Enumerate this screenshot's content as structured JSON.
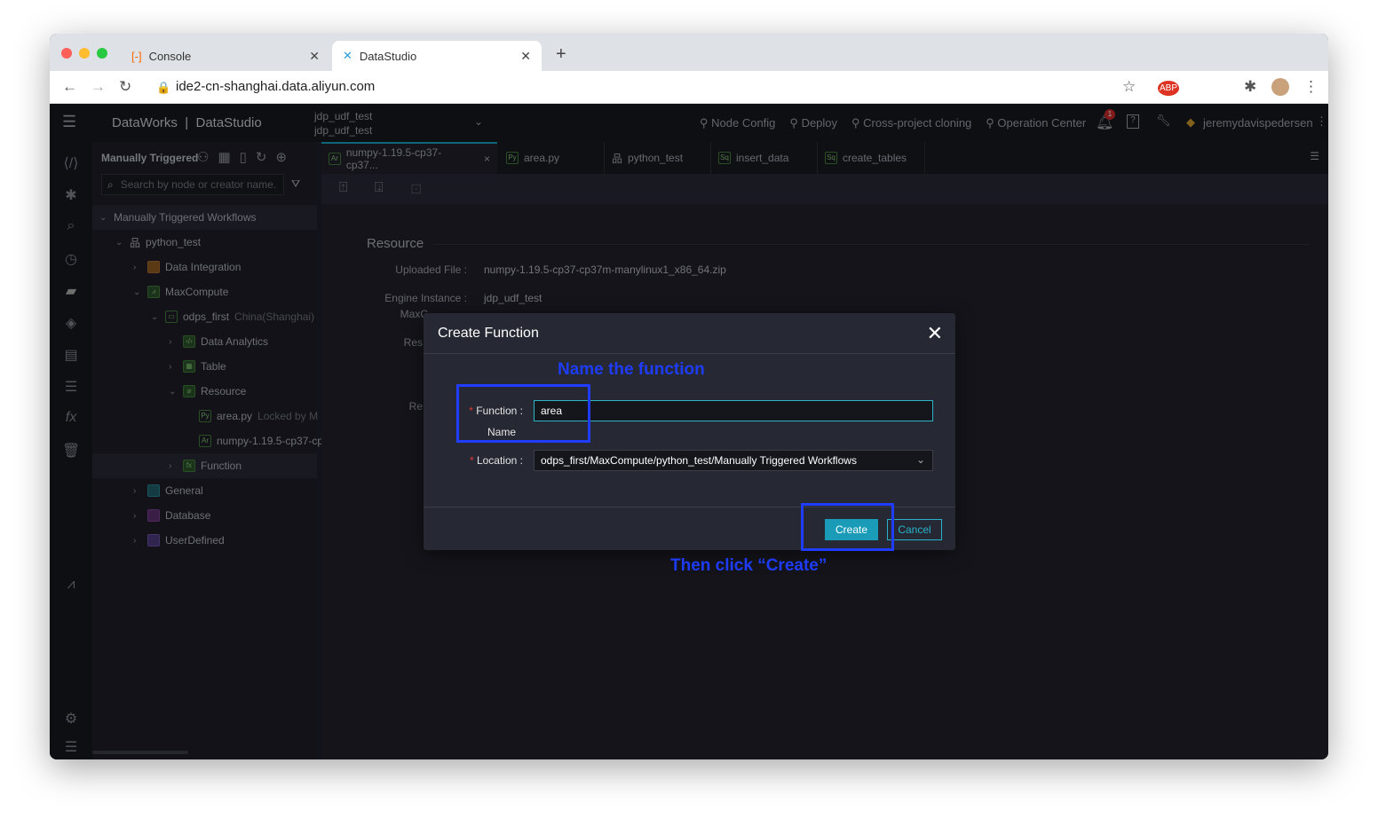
{
  "browser": {
    "tabs": [
      {
        "label": "Console"
      },
      {
        "label": "DataStudio"
      }
    ],
    "url": "ide2-cn-shanghai.data.aliyun.com"
  },
  "header": {
    "brand": "DataWorks",
    "product": "DataStudio",
    "workspace_line1": "jdp_udf_test",
    "workspace_line2": "jdp_udf_test",
    "links": [
      "Node Config",
      "Deploy",
      "Cross-project cloning",
      "Operation Center"
    ],
    "notification_count": "1",
    "user": "jeremydavispedersen"
  },
  "tree": {
    "title": "Manually Triggered",
    "search_placeholder": "Search by node or creator name.",
    "root": "Manually Triggered Workflows",
    "items": [
      {
        "label": "python_test",
        "note": ""
      },
      {
        "label": "Data Integration",
        "note": ""
      },
      {
        "label": "MaxCompute",
        "note": ""
      },
      {
        "label": "odps_first",
        "note": "China(Shanghai)"
      },
      {
        "label": "Data Analytics",
        "note": ""
      },
      {
        "label": "Table",
        "note": ""
      },
      {
        "label": "Resource",
        "note": ""
      },
      {
        "label": "area.py",
        "note": "Locked by M"
      },
      {
        "label": "numpy-1.19.5-cp37-cp",
        "note": ""
      },
      {
        "label": "Function",
        "note": ""
      },
      {
        "label": "General",
        "note": ""
      },
      {
        "label": "Database",
        "note": ""
      },
      {
        "label": "UserDefined",
        "note": ""
      }
    ]
  },
  "editor": {
    "tabs": [
      {
        "badge": "Ar",
        "label": "numpy-1.19.5-cp37-cp37..."
      },
      {
        "badge": "Py",
        "label": "area.py"
      },
      {
        "badge": "",
        "label": "python_test"
      },
      {
        "badge": "Sq",
        "label": "insert_data"
      },
      {
        "badge": "Sq",
        "label": "create_tables"
      }
    ],
    "section": "Resource",
    "fields": [
      {
        "label": "Uploaded File :",
        "value": "numpy-1.19.5-cp37-cp37m-manylinux1_x86_64.zip"
      },
      {
        "label": "Engine Instance :",
        "value": "jdp_udf_test"
      },
      {
        "label": "MaxC",
        "value": ""
      },
      {
        "label": "Res",
        "value": ""
      },
      {
        "label": "Re",
        "value": ""
      }
    ]
  },
  "modal": {
    "title": "Create Function",
    "function_label": "Function :",
    "function_label2": "Name",
    "function_value": "area",
    "location_label": "Location :",
    "location_value": "odps_first/MaxCompute/python_test/Manually Triggered Workflows",
    "create": "Create",
    "cancel": "Cancel"
  },
  "annotations": {
    "top": "Name the function",
    "bottom": "Then click “Create”",
    "color": "#1f3cff"
  },
  "colors": {
    "accent": "#1a9cb8"
  }
}
